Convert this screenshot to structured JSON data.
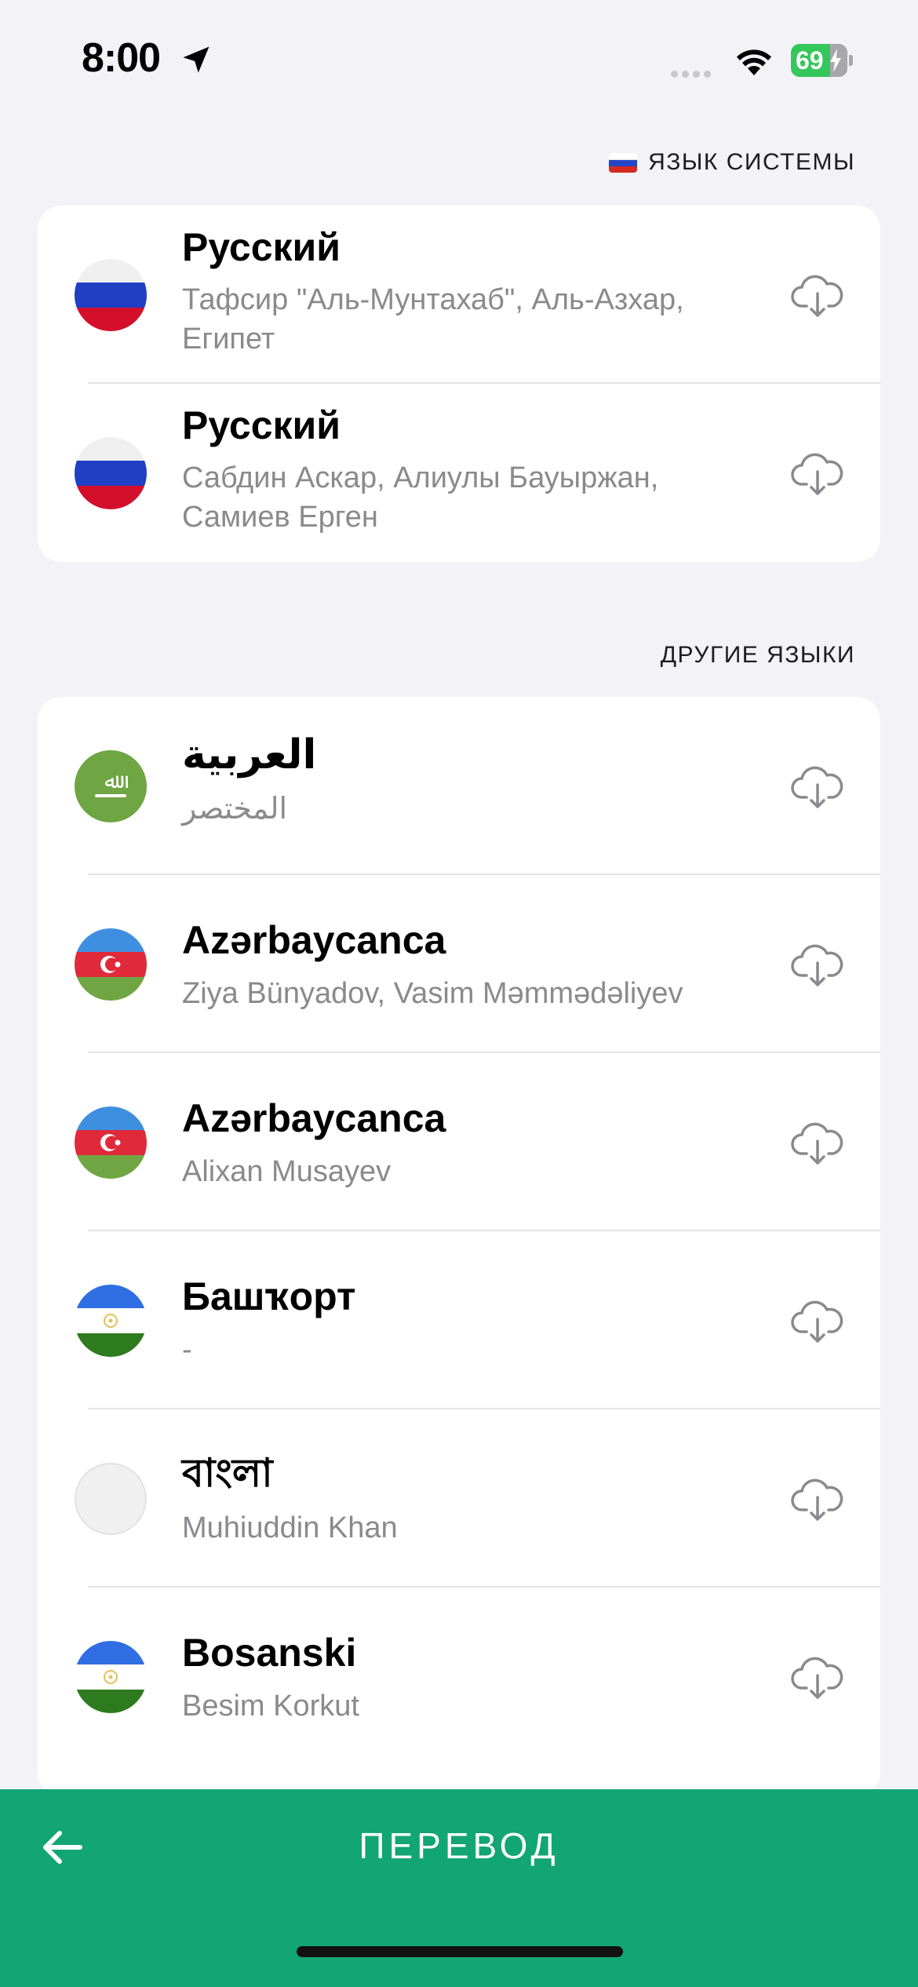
{
  "status_bar": {
    "time": "8:00",
    "battery_level": "69",
    "battery_fraction": 0.69,
    "icons": [
      "location-arrow-icon",
      "cellular-signal-icon",
      "wifi-icon",
      "battery-charging-icon"
    ]
  },
  "system_section": {
    "header": "ЯЗЫК СИСТЕМЫ",
    "items": [
      {
        "title": "Русский",
        "subtitle": "Тафсир \"Аль-Мунтахаб\", Аль-Азхар, Египет",
        "flag": "ru-flag-icon"
      },
      {
        "title": "Русский",
        "subtitle": "Сабдин Аскар, Алиулы Бауыржан, Самиев Ерген",
        "flag": "ru-flag-icon"
      }
    ]
  },
  "other_section": {
    "header": "ДРУГИЕ ЯЗЫКИ",
    "items": [
      {
        "title": "العربية",
        "subtitle": "المختصر",
        "flag": "arabic-flag-icon"
      },
      {
        "title": "Azərbaycanca",
        "subtitle": "Ziya Bünyadov, Vasim Məmmədəliyev",
        "flag": "az-flag-icon"
      },
      {
        "title": "Azərbaycanca",
        "subtitle": "Alixan Musayev",
        "flag": "az-flag-icon"
      },
      {
        "title": "Башҡорт",
        "subtitle": "-",
        "flag": "bashkort-flag-icon"
      },
      {
        "title": "বাংলা",
        "subtitle": "Muhiuddin Khan",
        "flag": "blank-flag-icon"
      },
      {
        "title": "Bosanski",
        "subtitle": "Besim Korkut",
        "flag": "bashkort-flag-icon"
      }
    ]
  },
  "nav": {
    "title": "ПЕРЕВОД",
    "back_icon": "back-arrow-icon"
  },
  "colors": {
    "accent": "#11a673",
    "background": "#f2f2f7",
    "subtitle": "#8a8a8e"
  }
}
